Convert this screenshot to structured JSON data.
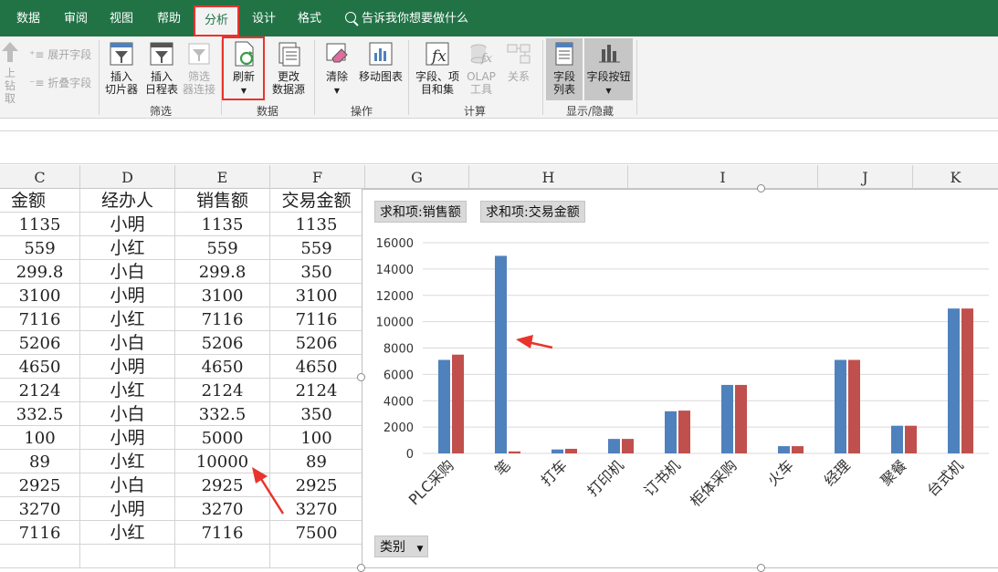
{
  "ribbon": {
    "tabs": [
      "数据",
      "审阅",
      "视图",
      "帮助",
      "分析",
      "设计",
      "格式"
    ],
    "active_tab": "分析",
    "tell_me": "告诉我你想要做什么",
    "left_partial": {
      "up_label": "上钻",
      "up_label2": "取",
      "expand": "展开字段",
      "collapse": "折叠字段"
    },
    "buttons": {
      "slicer": "插入\n切片器",
      "timeline": "插入\n日程表",
      "filter_conn": "筛选\n器连接",
      "refresh": "刷新",
      "change_source": "更改\n数据源",
      "clear": "清除",
      "move_chart": "移动图表",
      "fields_items": "字段、项\n目和集",
      "olap": "OLAP\n工具",
      "relations": "关系",
      "field_list": "字段\n列表",
      "field_buttons": "字段按钮"
    },
    "groups": {
      "filter": "筛选",
      "data": "数据",
      "actions": "操作",
      "calc": "计算",
      "show_hide": "显示/隐藏"
    }
  },
  "columns": [
    "C",
    "D",
    "E",
    "F",
    "G",
    "H",
    "I",
    "J",
    "K"
  ],
  "table": {
    "headers": [
      "金额",
      "经办人",
      "销售额",
      "交易金额"
    ],
    "rows": [
      [
        "1135",
        "小明",
        "1135",
        "1135"
      ],
      [
        "559",
        "小红",
        "559",
        "559"
      ],
      [
        "299.8",
        "小白",
        "299.8",
        "350"
      ],
      [
        "3100",
        "小明",
        "3100",
        "3100"
      ],
      [
        "7116",
        "小红",
        "7116",
        "7116"
      ],
      [
        "5206",
        "小白",
        "5206",
        "5206"
      ],
      [
        "4650",
        "小明",
        "4650",
        "4650"
      ],
      [
        "2124",
        "小红",
        "2124",
        "2124"
      ],
      [
        "332.5",
        "小白",
        "332.5",
        "350"
      ],
      [
        "100",
        "小明",
        "5000",
        "100"
      ],
      [
        "89",
        "小红",
        "10000",
        "89"
      ],
      [
        "2925",
        "小白",
        "2925",
        "2925"
      ],
      [
        "3270",
        "小明",
        "3270",
        "3270"
      ],
      [
        "7116",
        "小红",
        "7116",
        "7500"
      ]
    ]
  },
  "pivot_buttons": {
    "series1": "求和项:销售额",
    "series2": "求和项:交易金额",
    "category": "类别"
  },
  "colors": {
    "ribbon_green": "#217346",
    "series1": "#4f81bd",
    "series2": "#c0504d",
    "highlight": "#e8342c"
  },
  "chart_data": {
    "type": "bar",
    "categories": [
      "PLC采购",
      "笔",
      "打车",
      "打印机",
      "订书机",
      "柜体采购",
      "火车",
      "经理",
      "聚餐",
      "台式机"
    ],
    "series": [
      {
        "name": "求和项:销售额",
        "values": [
          7100,
          15000,
          300,
          1100,
          3200,
          5200,
          550,
          7100,
          2100,
          11000
        ]
      },
      {
        "name": "求和项:交易金额",
        "values": [
          7500,
          150,
          350,
          1100,
          3250,
          5200,
          550,
          7100,
          2100,
          11000
        ]
      }
    ],
    "ylim": [
      0,
      16000
    ],
    "yticks": [
      "0",
      "2000",
      "4000",
      "6000",
      "8000",
      "10000",
      "12000",
      "14000",
      "16000"
    ],
    "grid": true,
    "legend": "top-left"
  }
}
